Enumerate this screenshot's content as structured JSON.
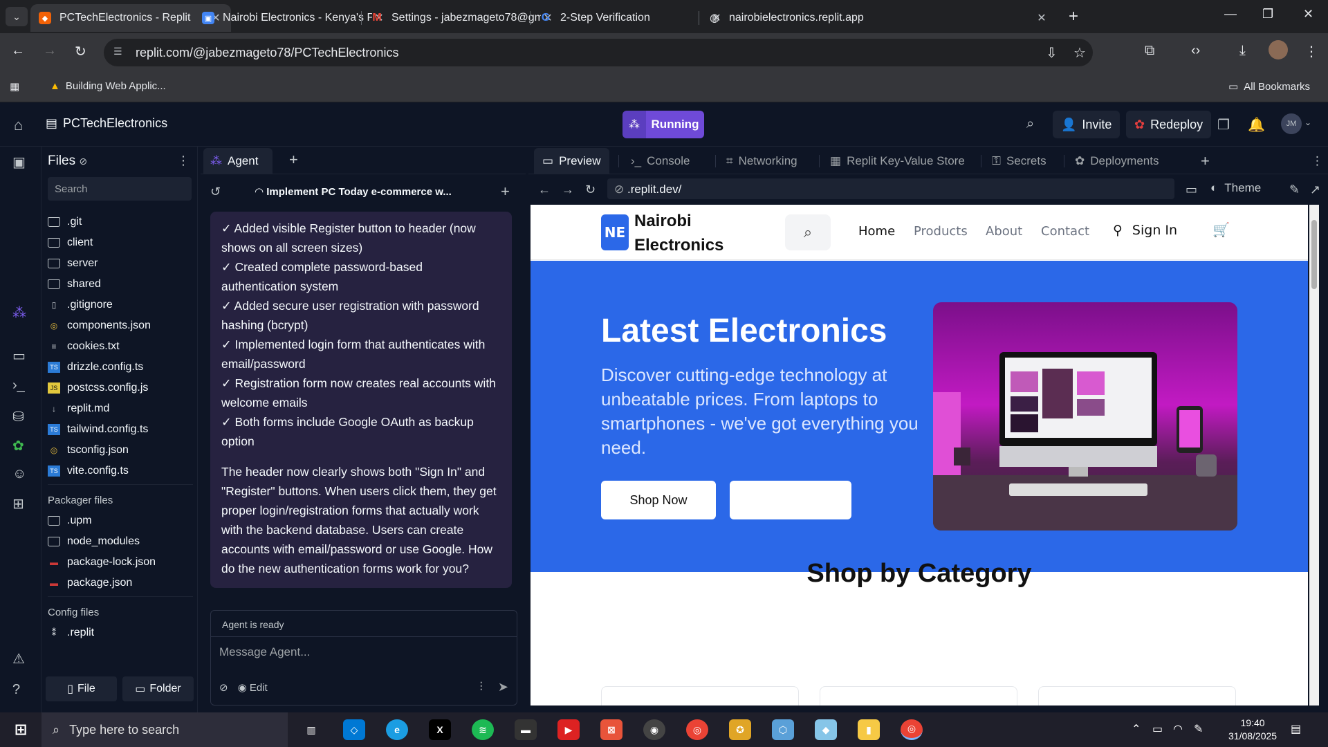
{
  "browser": {
    "tabs": [
      {
        "title": "PCTechElectronics - Replit",
        "active": true
      },
      {
        "title": "Nairobi Electronics - Kenya's Pr",
        "active": false
      },
      {
        "title": "Settings - jabezmageto78@gm",
        "active": false
      },
      {
        "title": "2-Step Verification",
        "active": false
      },
      {
        "title": "nairobielectronics.replit.app",
        "active": false
      }
    ],
    "url": "replit.com/@jabezmageto78/PCTechElectronics",
    "bookmark": "Building Web Applic...",
    "all_bookmarks": "All Bookmarks"
  },
  "replit": {
    "project_name": "PCTechElectronics",
    "run_label": "Running",
    "invite_label": "Invite",
    "redeploy_label": "Redeploy",
    "avatar": "JM"
  },
  "files": {
    "title": "Files",
    "search_placeholder": "Search",
    "items": [
      {
        "name": ".git",
        "icon": "folder"
      },
      {
        "name": "client",
        "icon": "folder"
      },
      {
        "name": "server",
        "icon": "folder"
      },
      {
        "name": "shared",
        "icon": "folder"
      },
      {
        "name": ".gitignore",
        "icon": "file"
      },
      {
        "name": "components.json",
        "icon": "json"
      },
      {
        "name": "cookies.txt",
        "icon": "text"
      },
      {
        "name": "drizzle.config.ts",
        "icon": "ts"
      },
      {
        "name": "postcss.config.js",
        "icon": "js"
      },
      {
        "name": "replit.md",
        "icon": "md"
      },
      {
        "name": "tailwind.config.ts",
        "icon": "ts"
      },
      {
        "name": "tsconfig.json",
        "icon": "json"
      },
      {
        "name": "vite.config.ts",
        "icon": "ts"
      }
    ],
    "packager_label": "Packager files",
    "packager_items": [
      {
        "name": ".upm",
        "icon": "folder"
      },
      {
        "name": "node_modules",
        "icon": "folder"
      },
      {
        "name": "package-lock.json",
        "icon": "npm"
      },
      {
        "name": "package.json",
        "icon": "npm"
      }
    ],
    "config_label": "Config files",
    "config_items": [
      {
        "name": ".replit",
        "icon": "replit"
      }
    ],
    "file_btn": "File",
    "folder_btn": "Folder"
  },
  "agent": {
    "tab_label": "Agent",
    "thread_title": "Implement PC Today e-commerce w...",
    "message_lines": [
      "✓ Added visible Register button to header (now shows on all screen sizes)",
      "✓ Created complete password-based authentication system",
      "✓ Added secure user registration with password hashing (bcrypt)",
      "✓ Implemented login form that authenticates with email/password",
      "✓ Registration form now creates real accounts with welcome emails",
      "✓ Both forms include Google OAuth as backup option"
    ],
    "message_para": "The header now clearly shows both \"Sign In\" and \"Register\" buttons. When users click them, they get proper login/registration forms that actually work with the backend database. Users can create accounts with email/password or use Google. How do the new authentication forms work for you?",
    "status": "Agent is ready",
    "composer_placeholder": "Message Agent...",
    "edit_label": "Edit"
  },
  "pane": {
    "tabs": [
      "Preview",
      "Console",
      "Networking",
      "Replit Key-Value Store",
      "Secrets",
      "Deployments"
    ],
    "url": ".replit.dev/",
    "theme_label": "Theme"
  },
  "site": {
    "logo": "NE",
    "brand_line1": "Nairobi",
    "brand_line2": "Electronics",
    "nav": [
      "Home",
      "Products",
      "About",
      "Contact"
    ],
    "sign_in": "Sign In",
    "hero_title": "Latest Electronics",
    "hero_text": "Discover cutting-edge technology at unbeatable prices. From laptops to smartphones - we've got everything you need.",
    "shop_now": "Shop Now",
    "category_heading": "Shop by Category"
  },
  "taskbar": {
    "search_placeholder": "Type here to search",
    "time": "19:40",
    "date": "31/08/2025"
  }
}
